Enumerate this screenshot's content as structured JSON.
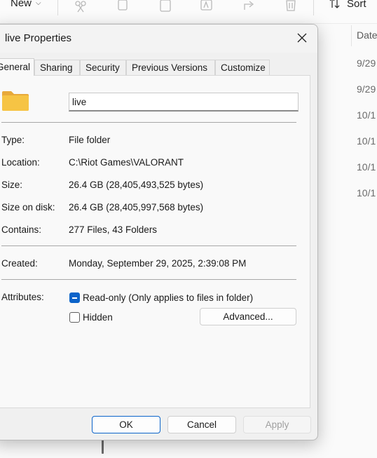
{
  "explorer": {
    "toolbar": {
      "new_label": "New",
      "sort_label": "Sort"
    },
    "column_header": "Date",
    "dates": [
      "9/29",
      "9/29",
      "10/1",
      "10/1",
      "10/1",
      "10/1"
    ]
  },
  "dialog": {
    "title": "live Properties",
    "tabs": [
      "General",
      "Sharing",
      "Security",
      "Previous Versions",
      "Customize"
    ],
    "active_tab": "General",
    "folder_name": "live",
    "rows": {
      "type": {
        "label": "Type:",
        "value": "File folder"
      },
      "location": {
        "label": "Location:",
        "value": "C:\\Riot Games\\VALORANT"
      },
      "size": {
        "label": "Size:",
        "value": "26.4 GB (28,405,493,525 bytes)"
      },
      "size_on_disk": {
        "label": "Size on disk:",
        "value": "26.4 GB (28,405,997,568 bytes)"
      },
      "contains": {
        "label": "Contains:",
        "value": "277 Files, 43 Folders"
      },
      "created": {
        "label": "Created:",
        "value": "Monday, September 29, 2025, 2:39:08 PM"
      }
    },
    "attributes": {
      "label": "Attributes:",
      "readonly": {
        "label": "Read-only (Only applies to files in folder)",
        "state": "indeterminate"
      },
      "hidden": {
        "label": "Hidden",
        "state": "unchecked"
      },
      "advanced_label": "Advanced..."
    },
    "buttons": {
      "ok": "OK",
      "cancel": "Cancel",
      "apply": "Apply"
    },
    "colors": {
      "accent": "#0a63c9",
      "folder": "#f6c444"
    }
  }
}
